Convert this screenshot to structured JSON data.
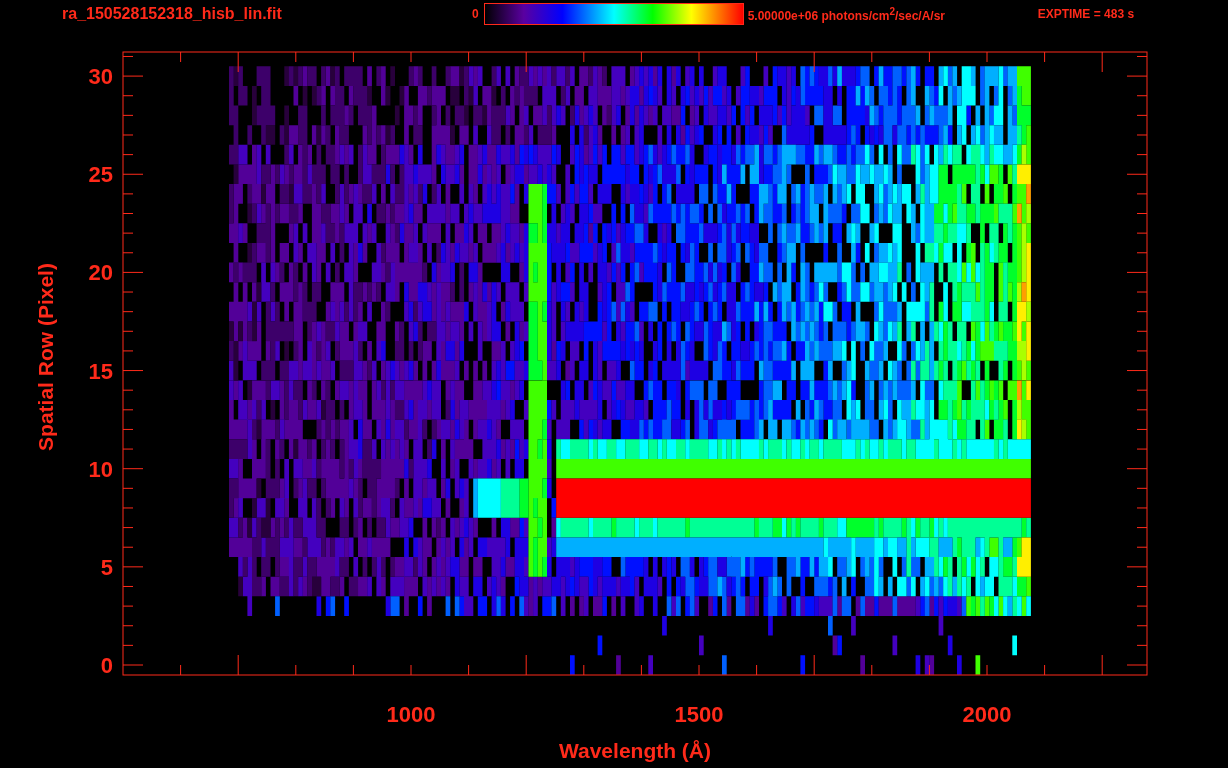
{
  "title": "ra_150528152318_hisb_lin.fit",
  "colorbar": {
    "min_label": "0",
    "max_label": "5.00000e+06 photons/cm$^{2}$/sec/A/sr"
  },
  "exposure": "EXPTIME = 483 s",
  "plot": {
    "ylabel": "Spatial Row (Pixel)",
    "xlabel": "Wavelength (Å)",
    "xticks": [
      "1000",
      "1500",
      "2000"
    ],
    "yticks": [
      "30",
      "25",
      "20",
      "15",
      "10",
      "5",
      "0"
    ]
  }
}
